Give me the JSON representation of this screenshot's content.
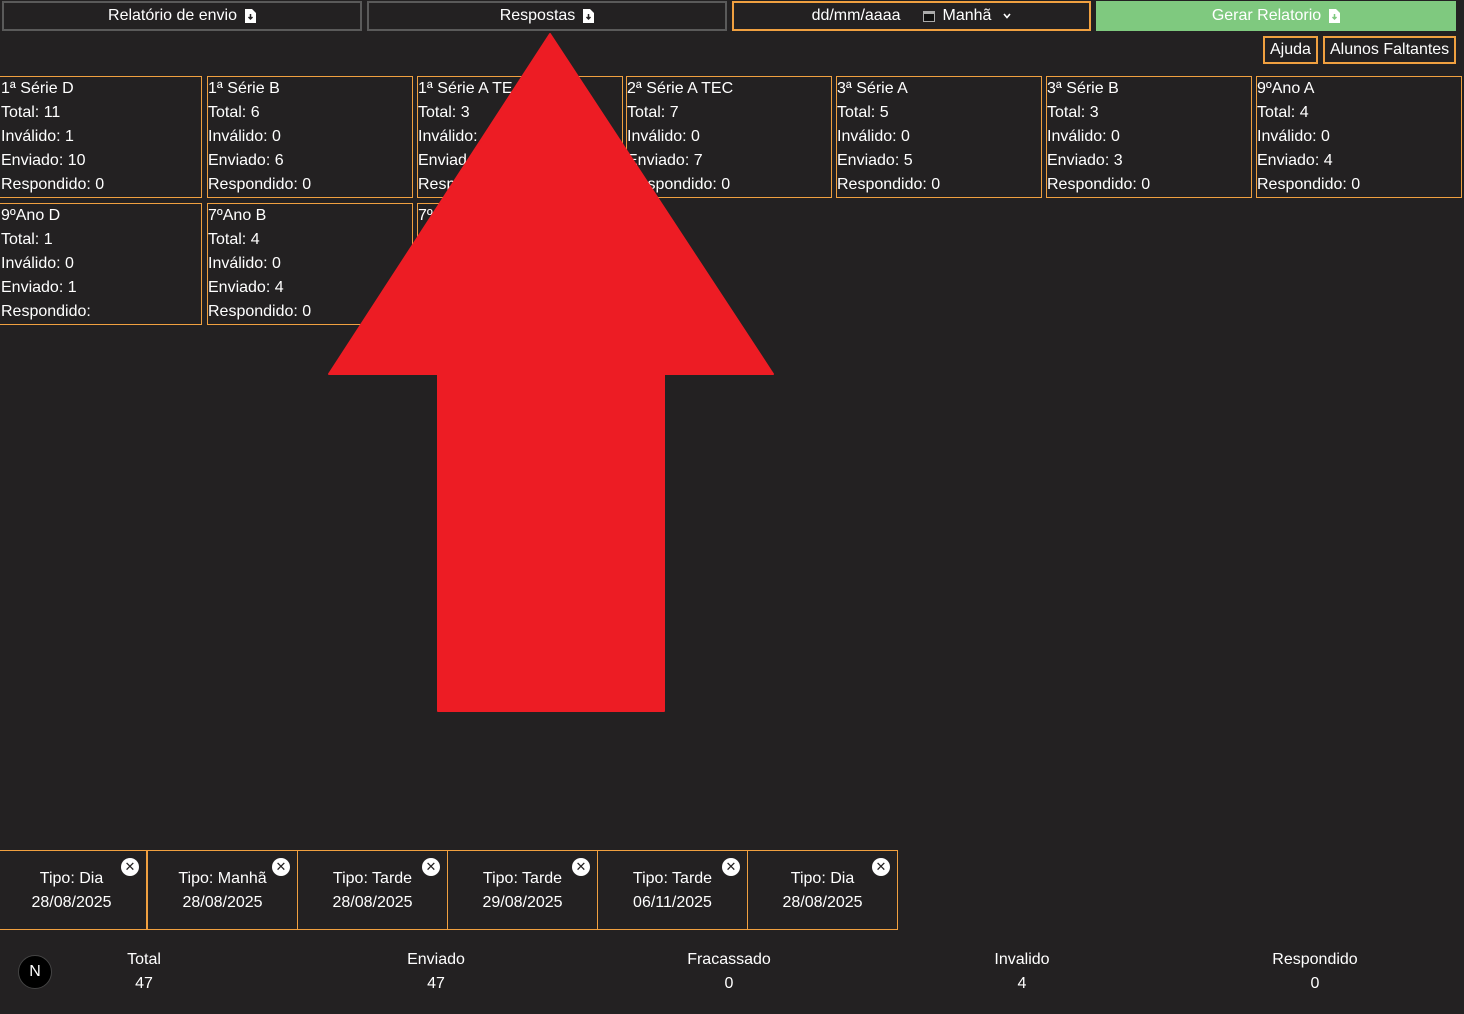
{
  "toolbar": {
    "envio_label": "Relatório de envio",
    "respostas_label": "Respostas",
    "date_placeholder": "dd/mm/aaaa",
    "shift_value": "Manhã",
    "gerar_label": "Gerar Relatorio",
    "ajuda_label": "Ajuda",
    "faltantes_label": "Alunos Faltantes"
  },
  "classes": [
    {
      "name": "1ª Série D",
      "total": "Total: 11",
      "invalido": "Inválido: 1",
      "enviado": "Enviado: 10",
      "respondido": "Respondido: 0"
    },
    {
      "name": "1ª Série B",
      "total": "Total: 6",
      "invalido": "Inválido: 0",
      "enviado": "Enviado: 6",
      "respondido": "Respondido: 0"
    },
    {
      "name": "1ª Série A TE",
      "total": "Total: 3",
      "invalido": "Inválido:",
      "enviado": "Enviad",
      "respondido": "Resp"
    },
    {
      "name": "2ª Série A TEC",
      "total": "Total: 7",
      "invalido": "Inválido: 0",
      "enviado": "Enviado: 7",
      "respondido": "Respondido: 0"
    },
    {
      "name": "3ª Série A",
      "total": "Total: 5",
      "invalido": "Inválido: 0",
      "enviado": "Enviado: 5",
      "respondido": "Respondido: 0"
    },
    {
      "name": "3ª Série B",
      "total": "Total: 3",
      "invalido": "Inválido: 0",
      "enviado": "Enviado: 3",
      "respondido": "Respondido: 0"
    },
    {
      "name": "9ºAno A",
      "total": "Total: 4",
      "invalido": "Inválido: 0",
      "enviado": "Enviado: 4",
      "respondido": "Respondido: 0"
    },
    {
      "name": "9ºAno D",
      "total": "Total: 1",
      "invalido": "Inválido: 0",
      "enviado": "Enviado: 1",
      "respondido": "Respondido:"
    },
    {
      "name": "7ºAno B",
      "total": "Total: 4",
      "invalido": "Inválido: 0",
      "enviado": "Enviado: 4",
      "respondido": "Respondido: 0"
    },
    {
      "name": "7º",
      "total": "",
      "invalido": "",
      "enviado": "",
      "respondido": ""
    }
  ],
  "reports": [
    {
      "tipo": "Tipo: Dia",
      "date": "28/08/2025"
    },
    {
      "tipo": "Tipo: Manhã",
      "date": "28/08/2025"
    },
    {
      "tipo": "Tipo: Tarde",
      "date": "28/08/2025"
    },
    {
      "tipo": "Tipo: Tarde",
      "date": "29/08/2025"
    },
    {
      "tipo": "Tipo: Tarde",
      "date": "06/11/2025"
    },
    {
      "tipo": "Tipo: Dia",
      "date": "28/08/2025"
    }
  ],
  "close_icon": "x-circle-icon",
  "stats": [
    {
      "label": "Total",
      "value": "47"
    },
    {
      "label": "Enviado",
      "value": "47"
    },
    {
      "label": "Fracassado",
      "value": "0"
    },
    {
      "label": "Invalido",
      "value": "4"
    },
    {
      "label": "Respondido",
      "value": "0"
    }
  ],
  "logo_letter": "N",
  "colors": {
    "background": "#232122",
    "accent_border": "#f0a040",
    "generate_button": "#7fc97f",
    "arrow": "#ed1c24"
  }
}
